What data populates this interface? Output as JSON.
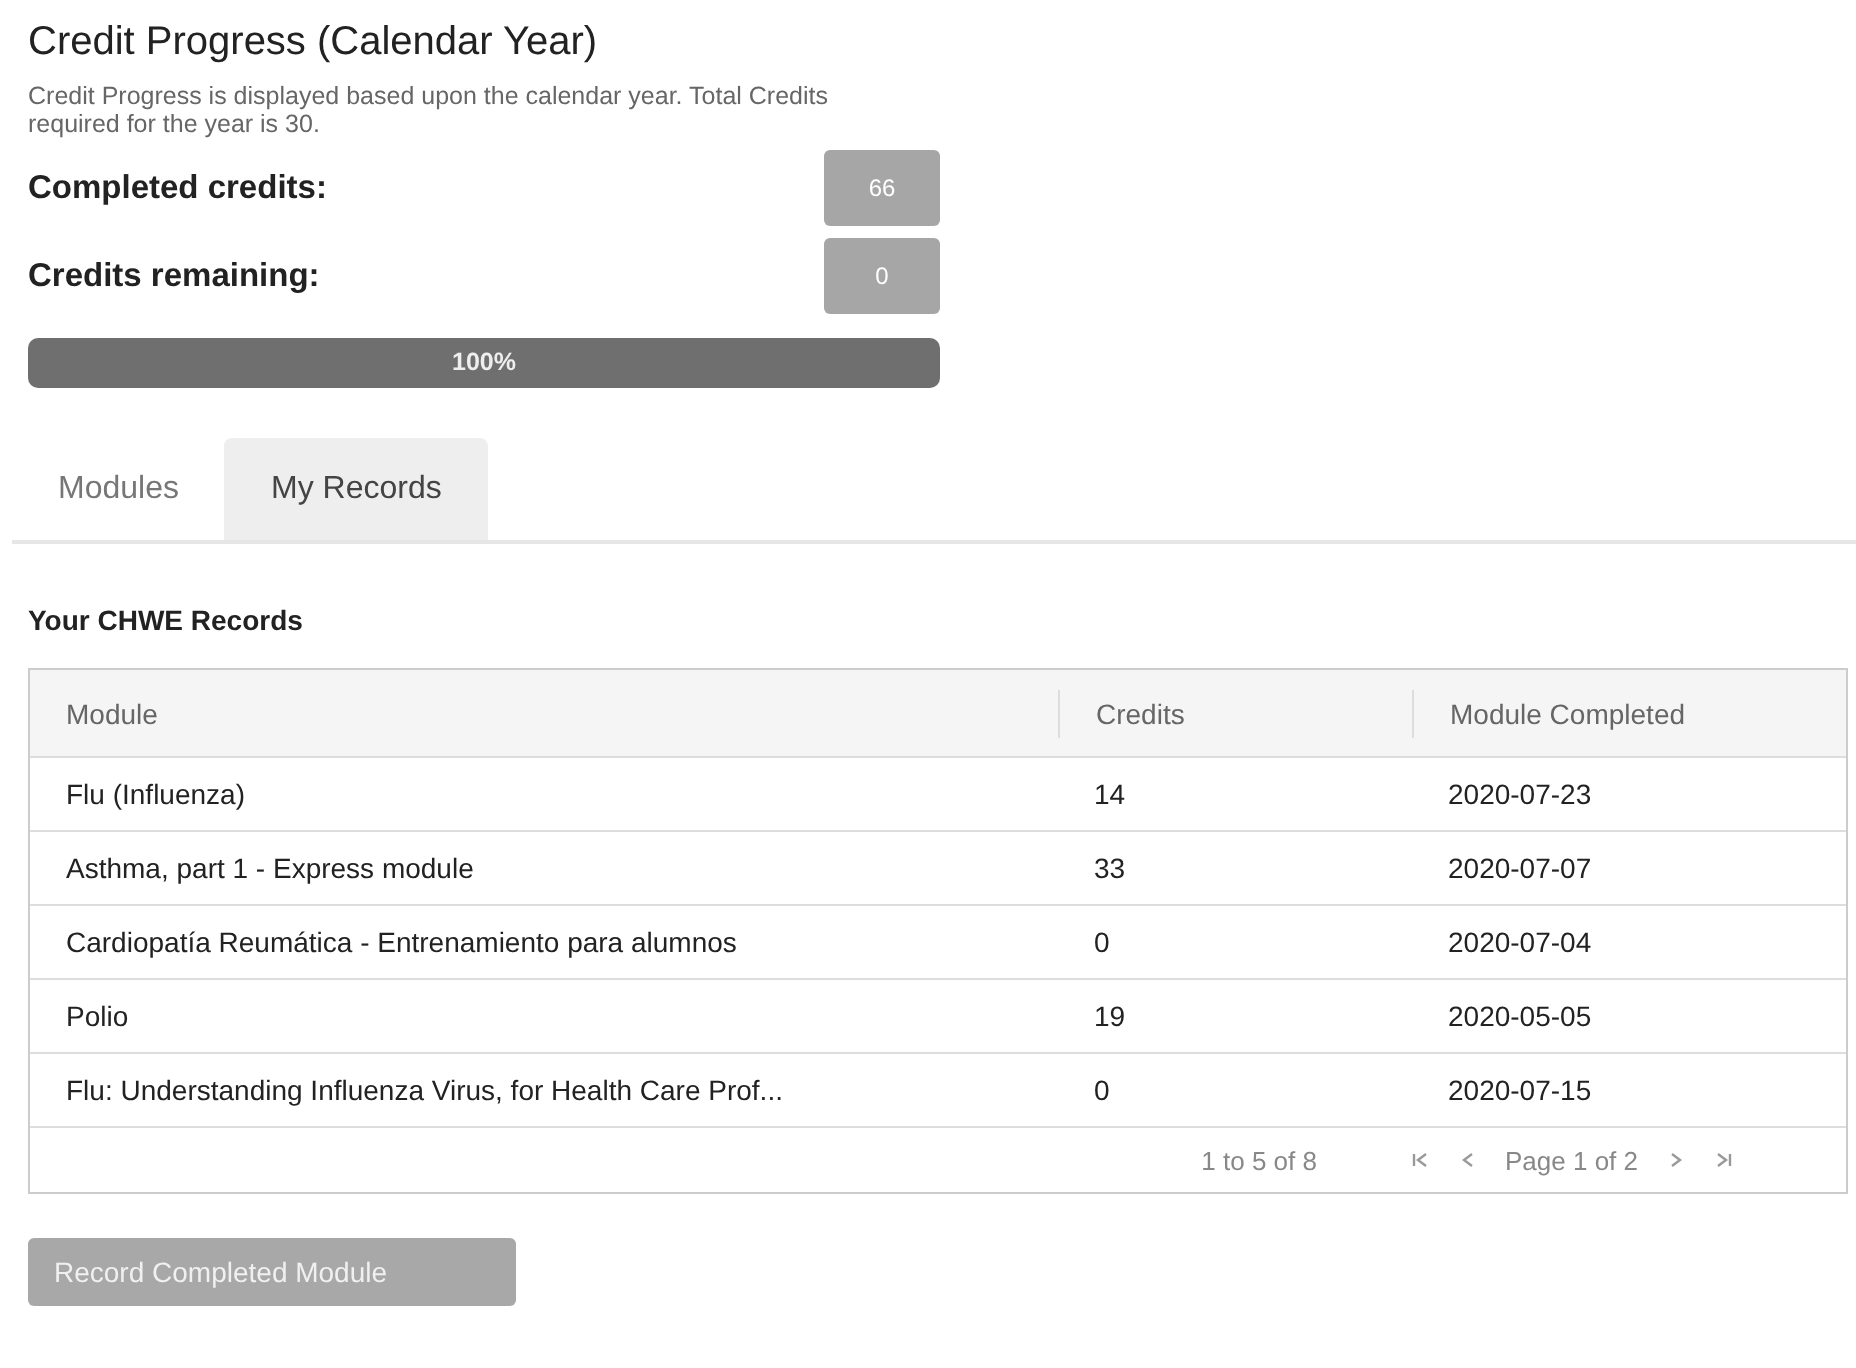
{
  "title": "Credit Progress (Calendar Year)",
  "description": "Credit Progress is displayed based upon the calendar year. Total Credits required for the year is 30.",
  "stats": [
    {
      "label": "Completed credits:",
      "value": "66"
    },
    {
      "label": "Credits remaining:",
      "value": "0"
    }
  ],
  "progress": {
    "level": 1,
    "reading": "100%"
  },
  "tabs": [
    {
      "label": "Modules",
      "selected": false
    },
    {
      "label": "My Records",
      "selected": true
    }
  ],
  "records_heading": "Your CHWE Records",
  "table": {
    "columns": [
      "Module",
      "Credits",
      "Module Completed"
    ],
    "rows": [
      [
        "Flu (Influenza)",
        "14",
        "2020-07-23"
      ],
      [
        "Asthma, part 1 - Express module",
        "33",
        "2020-07-07"
      ],
      [
        "Cardiopatía Reumática - Entrenamiento para alumnos",
        "0",
        "2020-07-04"
      ],
      [
        "Polio",
        "19",
        "2020-05-05"
      ],
      [
        "Flu: Understanding Influenza Virus, for Health Care Prof...",
        "0",
        "2020-07-15"
      ]
    ],
    "range": "1 to 5 of 8",
    "page": "Page 1 of 2"
  },
  "button": "Record Completed Module"
}
